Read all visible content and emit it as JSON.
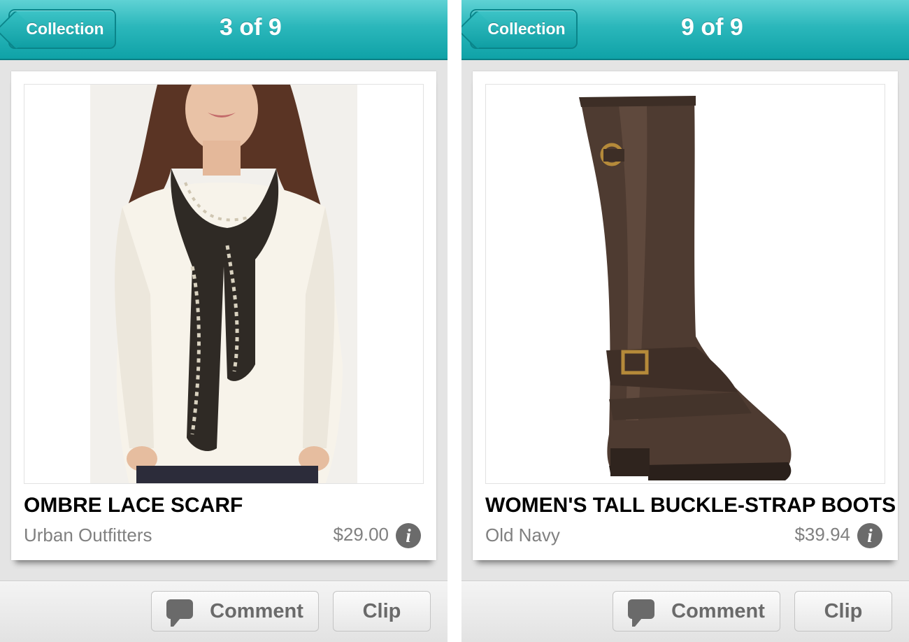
{
  "screens": [
    {
      "nav": {
        "back_label": "Collection",
        "position_label": "3 of 9"
      },
      "product": {
        "title": "OMBRE LACE SCARF",
        "store": "Urban Outfitters",
        "price": "$29.00",
        "info_icon": "i",
        "image_subject": "woman-wearing-lace-scarf"
      },
      "toolbar": {
        "comment_label": "Comment",
        "clip_label": "Clip"
      }
    },
    {
      "nav": {
        "back_label": "Collection",
        "position_label": "9 of 9"
      },
      "product": {
        "title": "WOMEN'S TALL BUCKLE-STRAP BOOTS",
        "store": "Old Navy",
        "price": "$39.94",
        "info_icon": "i",
        "image_subject": "tall-brown-buckle-boot"
      },
      "toolbar": {
        "comment_label": "Comment",
        "clip_label": "Clip"
      }
    }
  ],
  "colors": {
    "navbar_accent": "#1aaeb2",
    "background": "#e4e4e4",
    "secondary_text": "#808080",
    "button_text": "#6a6a6a"
  }
}
